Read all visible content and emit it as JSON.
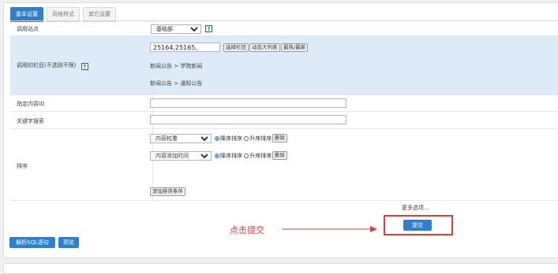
{
  "tabs": [
    {
      "label": "基本设置",
      "active": true
    },
    {
      "label": "风格样式",
      "active": false
    },
    {
      "label": "其它设置",
      "active": false
    }
  ],
  "site": {
    "label": "调用站点",
    "selected": "基础部"
  },
  "columns": {
    "label": "调用的栏目(不选则不限)",
    "value": "25164,25165,",
    "buttons": [
      "选择栏目",
      "动态大列表",
      "最热/最新"
    ],
    "paths": [
      "新闻公告 > 学院新闻",
      "新闻公告 > 通知公告"
    ]
  },
  "content_id": {
    "label": "指定内容ID",
    "value": ""
  },
  "keyword": {
    "label": "关键字搜索",
    "value": ""
  },
  "sort": {
    "label": "排序",
    "conditions": [
      {
        "field": "内容权重",
        "desc": "降序排序",
        "asc": "升序排序",
        "selected": "desc",
        "delete": "删除"
      },
      {
        "field": "内容添加时间",
        "desc": "降序排序",
        "asc": "升序排序",
        "selected": "desc",
        "delete": "删除"
      }
    ],
    "add_label": "添加排序条件"
  },
  "more_options": "更多选项...",
  "submit": "提交",
  "annotation": "点击提交",
  "actions": {
    "parse_sql": "解析SQL语句",
    "preview": "预览"
  },
  "colors": {
    "accent": "#2f7fd0",
    "highlight_row": "#ddeaf7",
    "annotation_red": "#e23b3b"
  },
  "icons": {
    "help": "help-icon",
    "dropdown": "chevron-down-icon",
    "arrow": "arrow-right-icon"
  }
}
